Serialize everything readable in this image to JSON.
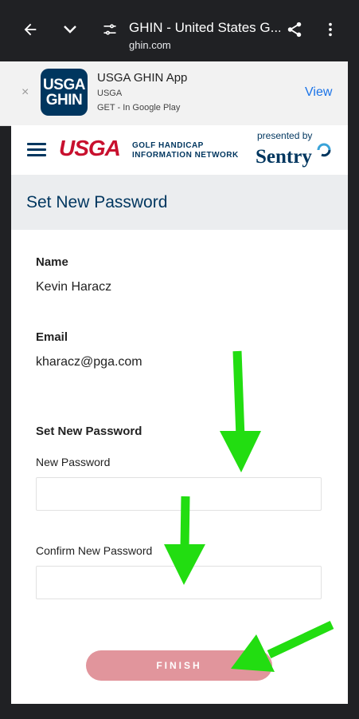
{
  "browser": {
    "title": "GHIN - United States G...",
    "url": "ghin.com"
  },
  "banner": {
    "icon_text_top": "USGA",
    "icon_text_bottom": "GHIN",
    "app_name": "USGA GHIN App",
    "publisher": "USGA",
    "get_text": "GET - In Google Play",
    "view_label": "View",
    "close_glyph": "×"
  },
  "header": {
    "logo_usga": "USGA",
    "network_line1": "GOLF HANDICAP",
    "network_line2": "INFORMATION NETWORK",
    "presented_by": "presented by",
    "sponsor": "Sentry"
  },
  "page": {
    "title": "Set New Password"
  },
  "form": {
    "name_label": "Name",
    "name_value": "Kevin Haracz",
    "email_label": "Email",
    "email_value": "kharacz@pga.com",
    "section_label": "Set New Password",
    "new_password_label": "New Password",
    "new_password_value": "",
    "confirm_password_label": "Confirm New Password",
    "confirm_password_value": "",
    "finish_label": "FINISH"
  },
  "colors": {
    "brand_navy": "#00365f",
    "brand_red": "#c8102e",
    "finish_button": "#e1959c",
    "annotation_arrow": "#22dd11",
    "link_blue": "#1a73e8"
  },
  "icons": [
    "back-arrow-icon",
    "chevron-down-icon",
    "tune-icon",
    "share-icon",
    "more-vert-icon",
    "close-icon",
    "hamburger-menu-icon"
  ]
}
